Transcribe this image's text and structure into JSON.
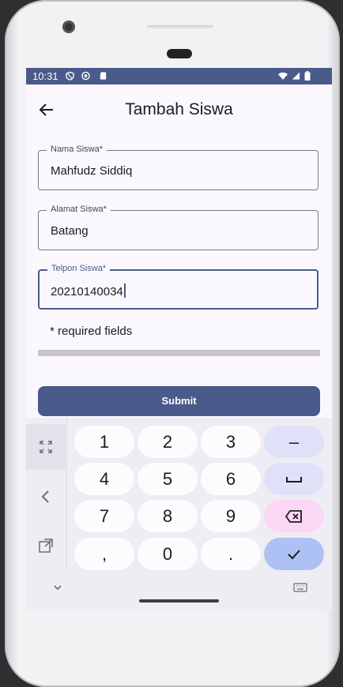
{
  "status_bar": {
    "time": "10:31"
  },
  "app_bar": {
    "title": "Tambah Siswa"
  },
  "form": {
    "fields": [
      {
        "label": "Nama Siswa*",
        "value": "Mahfudz Siddiq"
      },
      {
        "label": "Alamat Siswa*",
        "value": "Batang"
      },
      {
        "label": "Telpon Siswa*",
        "value": "20210140034"
      }
    ],
    "required_note": "* required fields",
    "submit_label": "Submit"
  },
  "keyboard": {
    "keys": [
      [
        "1",
        "2",
        "3",
        "–"
      ],
      [
        "4",
        "5",
        "6",
        "␣"
      ],
      [
        "7",
        "8",
        "9",
        "⌫"
      ],
      [
        ",",
        "0",
        ".",
        "✓"
      ]
    ]
  },
  "colors": {
    "primary": "#4a5a8a",
    "background": "#fbf8fd",
    "keyboard_bg": "#efedf4",
    "key_delete": "#fbd7f4",
    "key_confirm": "#aec1f4"
  }
}
